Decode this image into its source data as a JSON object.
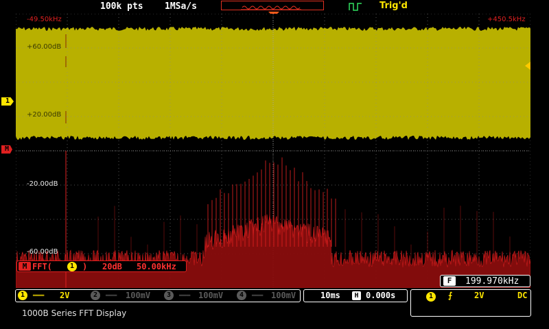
{
  "top_bar": {
    "points": "100k pts",
    "sample_rate": "1MSa/s",
    "trigger_status": "Trig'd"
  },
  "display": {
    "freq_start": "-49.50kHz",
    "freq_end": "+450.5kHz",
    "ch1_scale_labels": [
      "+60.00dB",
      "+20.00dB"
    ],
    "math_scale_labels": [
      "-20.00dB",
      "-60.00dB"
    ],
    "ch1_marker": "1",
    "math_marker": "M"
  },
  "fft_info": {
    "badge": "M",
    "func_prefix": "FFT(",
    "source": "1",
    "func_suffix": ")",
    "vertical_scale": "20dB",
    "horizontal_scale": "50.00kHz"
  },
  "freq_counter": {
    "badge": "F",
    "value": "199.970kHz"
  },
  "channels": [
    {
      "id": "1",
      "coupling_glyph": "═══",
      "scale": "2V",
      "active": true
    },
    {
      "id": "2",
      "coupling_glyph": "═══",
      "scale": "100mV",
      "active": false
    },
    {
      "id": "3",
      "coupling_glyph": "═══",
      "scale": "100mV",
      "active": false
    },
    {
      "id": "4",
      "coupling_glyph": "═══",
      "scale": "100mV",
      "active": false
    }
  ],
  "timebase": {
    "scale": "10ms",
    "position_badge": "H",
    "offset": "0.000s"
  },
  "trigger": {
    "source": "1",
    "edge_glyph": "⨍",
    "level": "2V",
    "coupling": "DC"
  },
  "caption": "1000B Series FFT Display",
  "colors": {
    "ch1": "#ffe600",
    "math": "#e02020",
    "trace_fill": "#b8b000"
  }
}
